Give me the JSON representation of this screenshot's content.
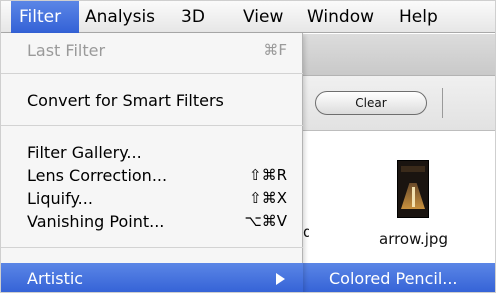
{
  "menubar": {
    "items": [
      {
        "label": "Filter"
      },
      {
        "label": "Analysis"
      },
      {
        "label": "3D"
      },
      {
        "label": "View"
      },
      {
        "label": "Window"
      },
      {
        "label": "Help"
      }
    ]
  },
  "filter_menu": {
    "last_filter": {
      "label": "Last Filter",
      "shortcut": "⌘F"
    },
    "convert": {
      "label": "Convert for Smart Filters"
    },
    "gallery": {
      "label": "Filter Gallery..."
    },
    "lens": {
      "label": "Lens Correction...",
      "shortcut": "⇧⌘R"
    },
    "liquify": {
      "label": "Liquify...",
      "shortcut": "⇧⌘X"
    },
    "vanishing": {
      "label": "Vanishing Point...",
      "shortcut": "⌥⌘V"
    },
    "artistic": {
      "label": "Artistic"
    }
  },
  "submenu": {
    "first_item": "Colored Pencil..."
  },
  "app": {
    "clear_button": "Clear",
    "thumb_label": "arrow.jpg",
    "hidden_text": "g"
  }
}
